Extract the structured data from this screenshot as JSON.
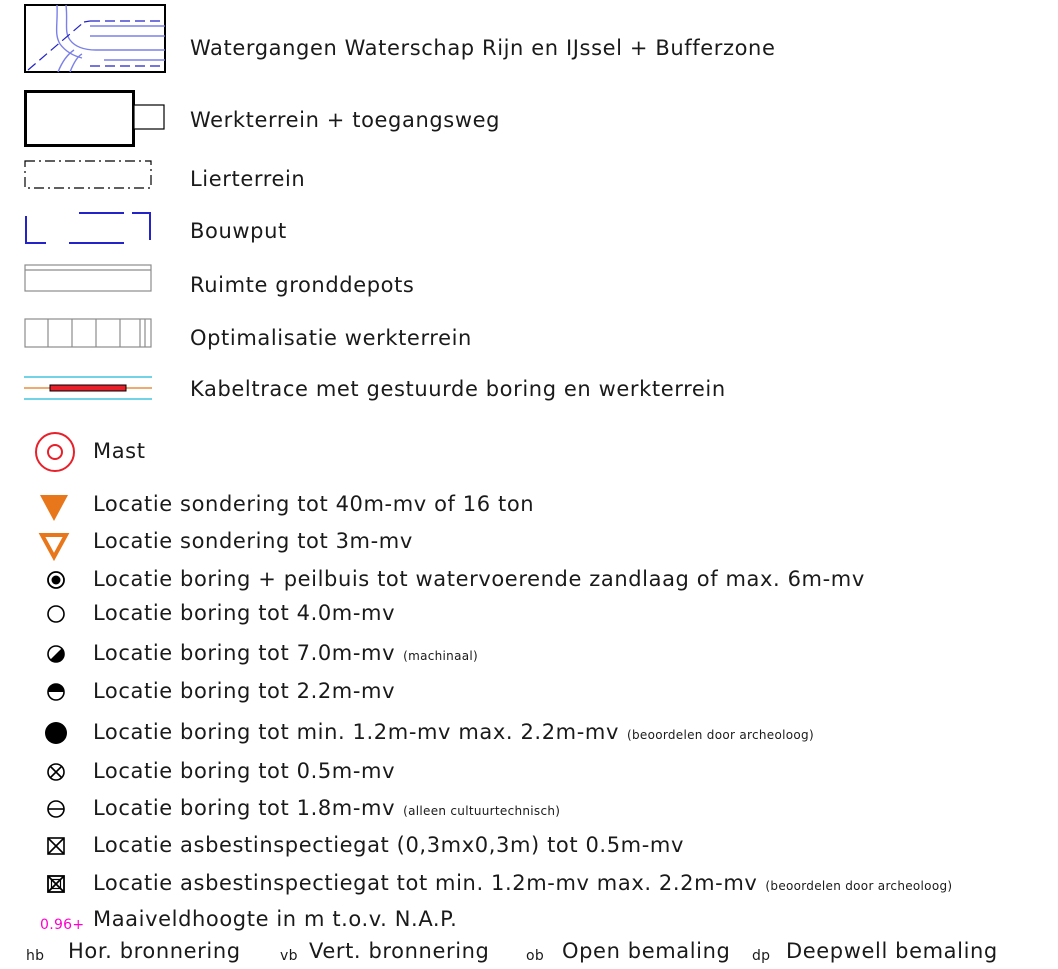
{
  "legend": {
    "areas": [
      {
        "id": "watergangen",
        "label": "Watergangen Waterschap Rijn en IJssel + Bufferzone",
        "icon": "waterways-hatch-icon"
      },
      {
        "id": "werkterrein",
        "label": "Werkterrein + toegangsweg",
        "icon": "work-area-rectangle-icon"
      },
      {
        "id": "lierterrein",
        "label": "Lierterrein",
        "icon": "dash-dot-rectangle-icon"
      },
      {
        "id": "bouwput",
        "label": "Bouwput",
        "icon": "blue-dashed-bracket-icon"
      },
      {
        "id": "gronddepots",
        "label": "Ruimte gronddepots",
        "icon": "double-line-rectangle-icon"
      },
      {
        "id": "optimalisatie",
        "label": "Optimalisatie werkterrein",
        "icon": "segmented-rectangle-icon"
      },
      {
        "id": "kabeltrace",
        "label": "Kabeltrace met gestuurde boring en werkterrein",
        "icon": "cable-route-icon"
      }
    ],
    "points": [
      {
        "id": "mast",
        "label": "Mast",
        "note": "",
        "icon": "mast-circle-icon"
      },
      {
        "id": "sondering-40",
        "label": "Locatie sondering tot 40m-mv of 16 ton",
        "note": "",
        "icon": "filled-triangle-icon"
      },
      {
        "id": "sondering-3",
        "label": "Locatie sondering tot 3m-mv",
        "note": "",
        "icon": "hollow-triangle-icon"
      },
      {
        "id": "boring-peilbuis",
        "label": "Locatie boring + peilbuis tot watervoerende zandlaag of max. 6m-mv",
        "note": "",
        "icon": "dot-in-circle-icon"
      },
      {
        "id": "boring-4",
        "label": "Locatie boring tot 4.0m-mv",
        "note": "",
        "icon": "open-circle-icon"
      },
      {
        "id": "boring-7",
        "label": "Locatie boring tot 7.0m-mv",
        "note": "(machinaal)",
        "icon": "diagonal-half-circle-icon"
      },
      {
        "id": "boring-2-2",
        "label": "Locatie boring tot 2.2m-mv",
        "note": "",
        "icon": "half-filled-circle-icon"
      },
      {
        "id": "boring-min-max",
        "label": "Locatie boring tot min. 1.2m-mv max. 2.2m-mv",
        "note": "(beoordelen door archeoloog)",
        "icon": "filled-circle-icon"
      },
      {
        "id": "boring-0-5",
        "label": "Locatie boring tot 0.5m-mv",
        "note": "",
        "icon": "circled-x-icon"
      },
      {
        "id": "boring-1-8",
        "label": "Locatie boring tot 1.8m-mv",
        "note": "(alleen cultuurtechnisch)",
        "icon": "circled-minus-icon"
      },
      {
        "id": "asbest-0-5",
        "label": "Locatie asbestinspectiegat (0,3mx0,3m) tot 0.5m-mv",
        "note": "",
        "icon": "boxed-x-icon"
      },
      {
        "id": "asbest-min-max",
        "label": "Locatie asbestinspectiegat tot min. 1.2m-mv max. 2.2m-mv",
        "note": "(beoordelen door archeoloog)",
        "icon": "boxed-x-bold-icon"
      }
    ],
    "maaiveld": {
      "value": "0.96+",
      "label": "Maaiveldhoogte in m t.o.v. N.A.P."
    },
    "bronnering": [
      {
        "code": "hb",
        "label": "Hor. bronnering"
      },
      {
        "code": "vb",
        "label": "Vert. bronnering"
      },
      {
        "code": "ob",
        "label": "Open bemaling"
      },
      {
        "code": "dp",
        "label": "Deepwell bemaling"
      }
    ]
  },
  "colors": {
    "red": "#e8202a",
    "orange": "#e8771b",
    "blue": "#2323c8",
    "light_blue": "#7b80e8",
    "cyan": "#1fb7d6",
    "pink": "#ff00cc",
    "gray": "#8c8c8c"
  }
}
